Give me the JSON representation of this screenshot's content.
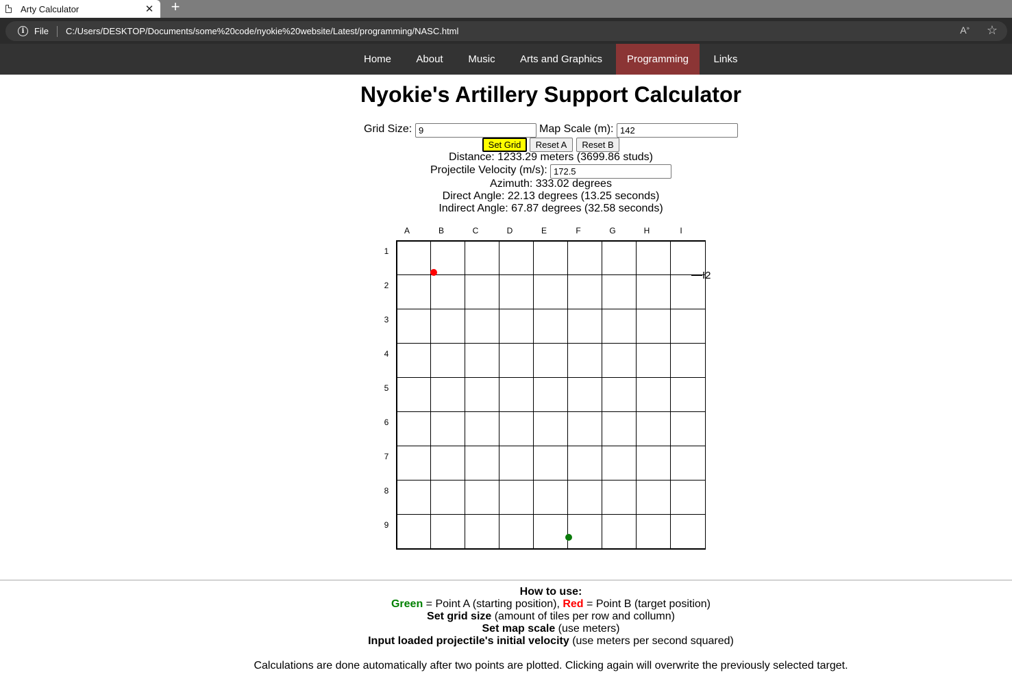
{
  "browser": {
    "tab_title": "Arty Calculator",
    "tab_close": "✕",
    "new_tab": "+",
    "file_label": "File",
    "url": "C:/Users/DESKTOP/Documents/some%20code/nyokie%20website/Latest/programming/NASC.html"
  },
  "nav": {
    "items": [
      "Home",
      "About",
      "Music",
      "Arts and Graphics",
      "Programming",
      "Links"
    ],
    "active": "Programming"
  },
  "page": {
    "title": "Nyokie's Artillery Support Calculator",
    "grid_size_label": "Grid Size:",
    "grid_size_value": "9",
    "map_scale_label": "Map Scale (m):",
    "map_scale_value": "142",
    "set_grid_button": "Set Grid",
    "reset_a_button": "Reset A",
    "reset_b_button": "Reset B",
    "distance_text": "Distance: 1233.29 meters (3699.86 studs)",
    "velocity_label": "Projectile Velocity (m/s):",
    "velocity_value": "172.5",
    "azimuth_text": "Azimuth: 333.02 degrees",
    "direct_angle_text": "Direct Angle: 22.13 degrees (13.25 seconds)",
    "indirect_angle_text": "Indirect Angle: 67.87 degrees (32.58 seconds)"
  },
  "grid": {
    "columns": [
      "A",
      "B",
      "C",
      "D",
      "E",
      "F",
      "G",
      "H",
      "I"
    ],
    "rows": [
      "1",
      "2",
      "3",
      "4",
      "5",
      "6",
      "7",
      "8",
      "9"
    ],
    "target_label": "I2",
    "point_a_color": "#0a7a0a",
    "point_b_color": "#ff0000"
  },
  "howto": {
    "heading": "How to use:",
    "green_word": "Green",
    "green_text": " = Point A (starting position), ",
    "red_word": "Red",
    "red_text": " = Point B (target position)",
    "set_grid_bold": "Set grid size",
    "set_grid_text": " (amount of tiles per row and collumn)",
    "map_scale_bold": "Set map scale",
    "map_scale_text": " (use meters)",
    "velocity_bold": "Input loaded projectile's initial velocity",
    "velocity_text": " (use meters per second squared)",
    "footer_text": "Calculations are done automatically after two points are plotted. Clicking again will overwrite the previously selected target."
  }
}
